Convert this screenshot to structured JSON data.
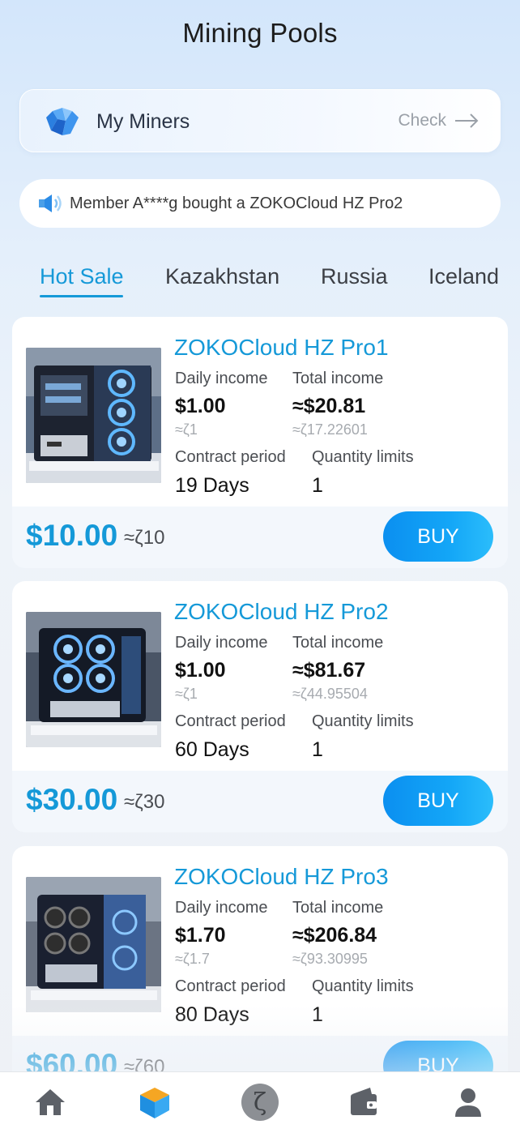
{
  "header": {
    "title": "Mining Pools"
  },
  "my_miners": {
    "label": "My Miners",
    "check_label": "Check"
  },
  "notice": {
    "text": "Member A****g bought a ZOKOCloud HZ Pro2"
  },
  "tabs": [
    {
      "label": "Hot Sale",
      "active": true
    },
    {
      "label": "Kazakhstan",
      "active": false
    },
    {
      "label": "Russia",
      "active": false
    },
    {
      "label": "Iceland",
      "active": false
    }
  ],
  "products": [
    {
      "name": "ZOKOCloud HZ Pro1",
      "daily_income_label": "Daily income",
      "daily_income": "$1.00",
      "daily_income_sub": "≈ζ1",
      "total_income_label": "Total income",
      "total_income": "≈$20.81",
      "total_income_sub": "≈ζ17.22601",
      "contract_label": "Contract period",
      "contract": "19 Days",
      "limit_label": "Quantity limits",
      "limit": "1",
      "price": "$10.00",
      "price_sub": "≈ζ10",
      "buy_label": "BUY"
    },
    {
      "name": "ZOKOCloud HZ Pro2",
      "daily_income_label": "Daily income",
      "daily_income": "$1.00",
      "daily_income_sub": "≈ζ1",
      "total_income_label": "Total income",
      "total_income": "≈$81.67",
      "total_income_sub": "≈ζ44.95504",
      "contract_label": "Contract period",
      "contract": "60 Days",
      "limit_label": "Quantity limits",
      "limit": "1",
      "price": "$30.00",
      "price_sub": "≈ζ30",
      "buy_label": "BUY"
    },
    {
      "name": "ZOKOCloud HZ Pro3",
      "daily_income_label": "Daily income",
      "daily_income": "$1.70",
      "daily_income_sub": "≈ζ1.7",
      "total_income_label": "Total income",
      "total_income": "≈$206.84",
      "total_income_sub": "≈ζ93.30995",
      "contract_label": "Contract period",
      "contract": "80 Days",
      "limit_label": "Quantity limits",
      "limit": "1",
      "price": "$60.00",
      "price_sub": "≈ζ60",
      "buy_label": "BUY"
    }
  ],
  "bottom_nav": {
    "items": [
      {
        "icon": "home-icon",
        "active": false
      },
      {
        "icon": "cube-icon",
        "active": true
      },
      {
        "icon": "zeta-icon",
        "label": "ζ",
        "active": false
      },
      {
        "icon": "wallet-icon",
        "active": false
      },
      {
        "icon": "user-icon",
        "active": false
      }
    ]
  },
  "colors": {
    "accent": "#1599d8",
    "button": "#0b8ff0"
  }
}
